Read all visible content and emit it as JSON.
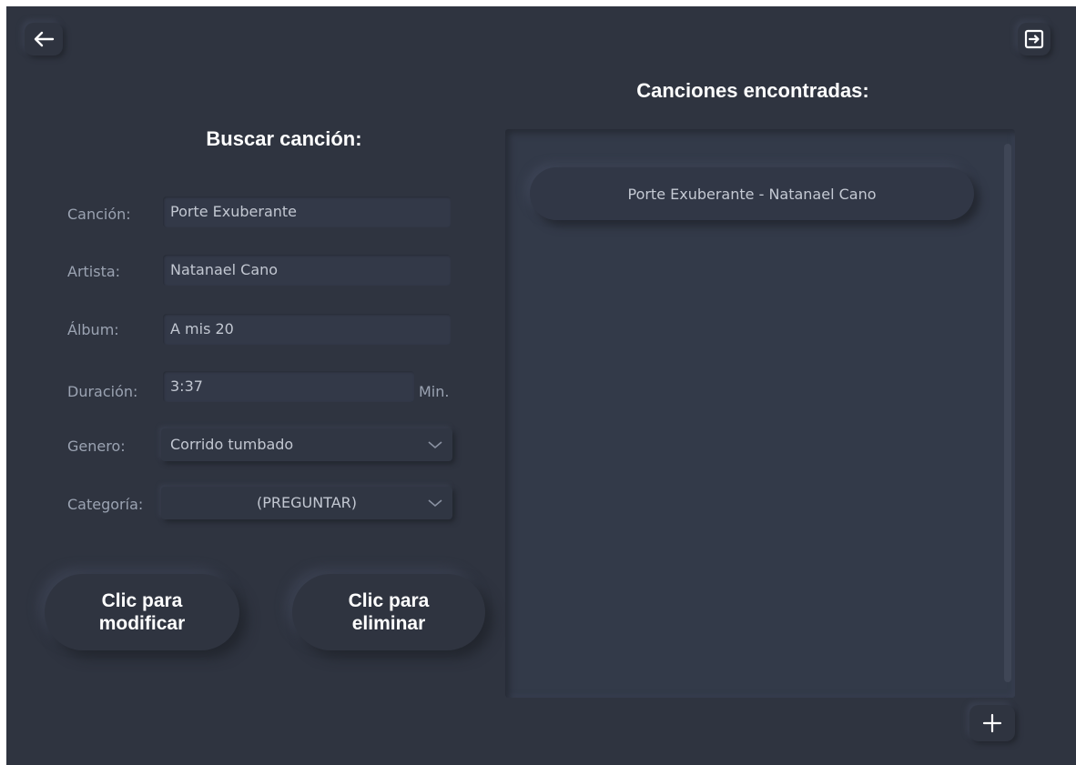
{
  "search": {
    "title": "Buscar canción:",
    "fields": {
      "cancion_label": "Canción:",
      "cancion_value": "Porte Exuberante",
      "artista_label": "Artista:",
      "artista_value": "Natanael Cano",
      "album_label": "Álbum:",
      "album_value": "A mis 20",
      "duracion_label": "Duración:",
      "duracion_value": "3:37",
      "duracion_unit": "Min.",
      "genero_label": "Genero:",
      "genero_value": "Corrido tumbado",
      "categoria_label": "Categoría:",
      "categoria_value": "(PREGUNTAR)"
    },
    "modify_button": "Clic para\nmodificar",
    "delete_button": "Clic para\neliminar"
  },
  "results": {
    "title": "Canciones encontradas:",
    "items": [
      {
        "label": "Porte Exuberante - Natanael Cano"
      }
    ]
  },
  "icons": {
    "back": "arrow-left-icon",
    "logout": "logout-icon",
    "add": "plus-icon"
  },
  "colors": {
    "background": "#2f3440",
    "title_text": "#ffffff",
    "label_text": "#9ba3b2"
  }
}
